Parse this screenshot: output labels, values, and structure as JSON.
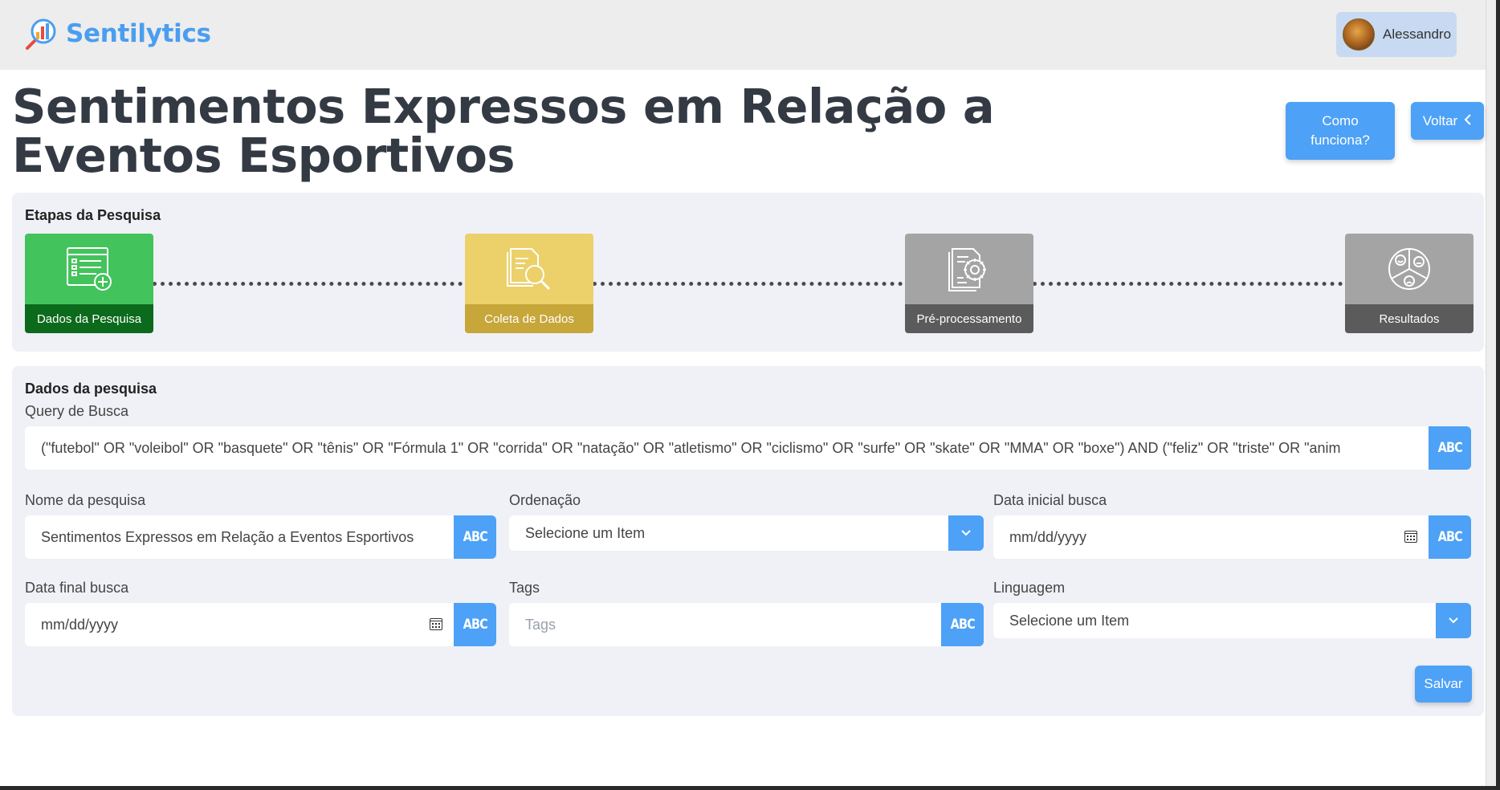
{
  "brand": {
    "name": "Sentilytics",
    "logo_icon": "magnifier-chart-logo"
  },
  "user": {
    "name": "Alessandro",
    "avatar_icon": "user-avatar"
  },
  "page": {
    "title": "Sentimentos Expressos em Relação a Eventos Esportivos",
    "how_it_works_label": "Como funciona?",
    "back_label": "Voltar"
  },
  "steps": {
    "title": "Etapas da Pesquisa",
    "items": [
      {
        "label": "Dados da Pesquisa",
        "icon": "form-list-icon",
        "status": "complete",
        "color": "#43c35c"
      },
      {
        "label": "Coleta de Dados",
        "icon": "document-search-icon",
        "status": "current",
        "color": "#ecd06a"
      },
      {
        "label": "Pré-processamento",
        "icon": "document-gear-icon",
        "status": "pending",
        "color": "#a4a4a4"
      },
      {
        "label": "Resultados",
        "icon": "sentiment-pie-icon",
        "status": "pending",
        "color": "#a4a4a4"
      }
    ]
  },
  "form": {
    "title": "Dados da pesquisa",
    "query": {
      "label": "Query de Busca",
      "value": "(\"futebol\" OR \"voleibol\" OR \"basquete\" OR \"tênis\" OR \"Fórmula 1\" OR \"corrida\" OR \"natação\" OR \"atletismo\" OR \"ciclismo\" OR \"surfe\" OR \"skate\" OR \"MMA\" OR \"boxe\") AND (\"feliz\" OR \"triste\" OR \"anim",
      "button": "ABC"
    },
    "name": {
      "label": "Nome da pesquisa",
      "value": "Sentimentos Expressos em Relação a Eventos Esportivos",
      "button": "ABC"
    },
    "ordering": {
      "label": "Ordenação",
      "selected": "Selecione um Item"
    },
    "start_date": {
      "label": "Data inicial busca",
      "placeholder": "mm/dd/yyyy",
      "button": "ABC"
    },
    "end_date": {
      "label": "Data final busca",
      "placeholder": "mm/dd/yyyy",
      "button": "ABC"
    },
    "tags": {
      "label": "Tags",
      "placeholder": "Tags",
      "button": "ABC"
    },
    "language": {
      "label": "Linguagem",
      "selected": "Selecione um Item"
    },
    "save_label": "Salvar"
  },
  "colors": {
    "accent": "#4da1f6",
    "brand": "#4a9ef0",
    "title": "#343a44",
    "panel": "#eff1f7"
  }
}
